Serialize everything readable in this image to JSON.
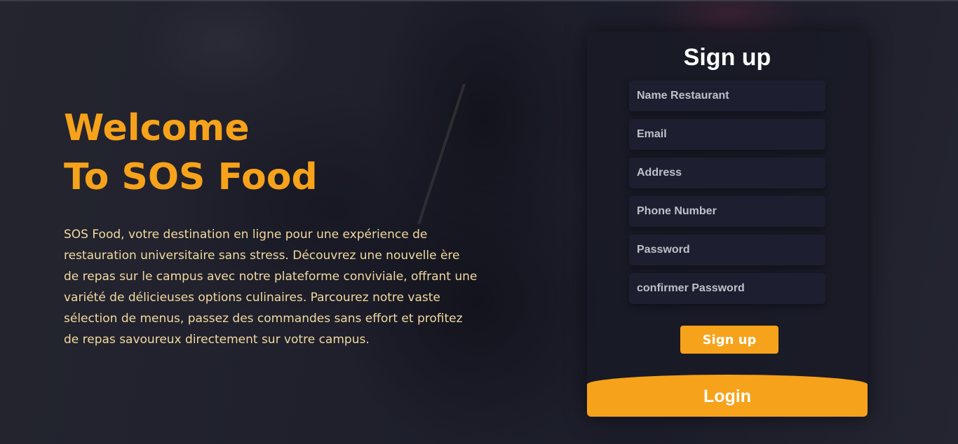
{
  "hero": {
    "title_line1": "Welcome",
    "title_line2": "To SOS Food",
    "description": "SOS Food, votre destination en ligne pour une expérience de restauration universitaire sans stress. Découvrez une nouvelle ère de repas sur le campus avec notre plateforme conviviale, offrant une variété de délicieuses options culinaires. Parcourez notre vaste sélection de menus, passez des commandes sans effort et profitez de repas savoureux directement sur votre campus."
  },
  "signup": {
    "title": "Sign up",
    "fields": {
      "name_restaurant": "Name Restaurant",
      "email": "Email",
      "address": "Address",
      "phone": "Phone Number",
      "password": "Password",
      "confirm_password": "confirmer Password"
    },
    "submit_label": "Sign up",
    "login_label": "Login"
  },
  "colors": {
    "accent": "#f7a21b",
    "background": "#1d1e2b",
    "body_text": "#f2d9a0"
  }
}
